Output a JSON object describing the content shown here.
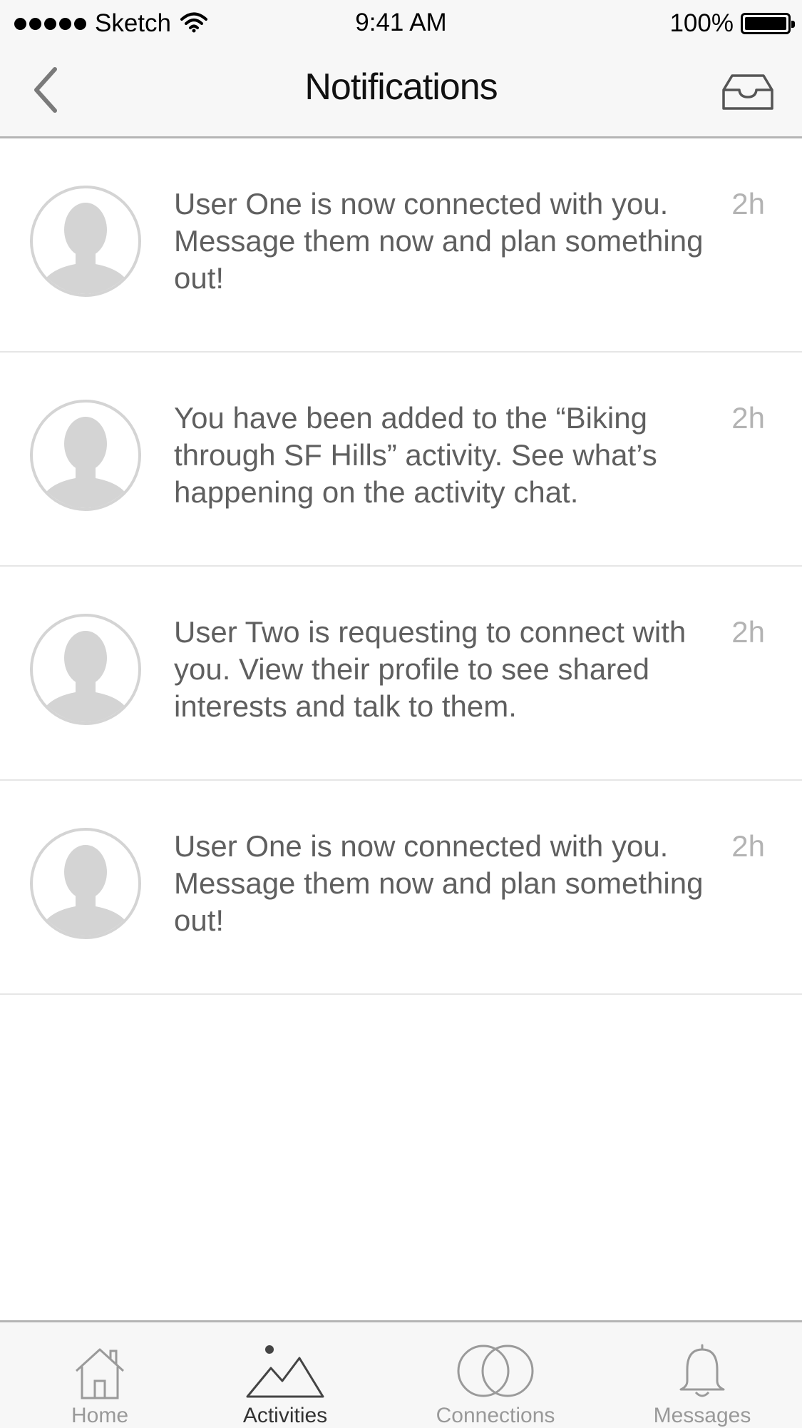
{
  "status_bar": {
    "carrier": "Sketch",
    "time": "9:41 AM",
    "battery": "100%",
    "signal_icon": "signal-dots-icon",
    "wifi_icon": "wifi-icon",
    "battery_icon": "battery-icon"
  },
  "nav": {
    "title": "Notifications",
    "back_icon": "chevron-left-icon",
    "inbox_icon": "inbox-tray-icon"
  },
  "notifications": [
    {
      "avatar_icon": "user-avatar-icon",
      "text": "User One is now connected with you. Message them now and plan something out!",
      "time": "2h"
    },
    {
      "avatar_icon": "user-avatar-icon",
      "text": "You have been added to the “Biking through SF Hills” activity. See what’s happening on the activity chat.",
      "time": "2h"
    },
    {
      "avatar_icon": "user-avatar-icon",
      "text": "User Two is requesting to connect with you. View their profile to see shared interests and talk to them.",
      "time": "2h"
    },
    {
      "avatar_icon": "user-avatar-icon",
      "text": "User One is now connected with you. Message them now and plan something out!",
      "time": "2h"
    }
  ],
  "tabs": [
    {
      "label": "Home",
      "icon": "home-icon",
      "active": false
    },
    {
      "label": "Activities",
      "icon": "mountain-icon",
      "active": true
    },
    {
      "label": "Connections",
      "icon": "connections-circles-icon",
      "active": false
    },
    {
      "label": "Messages",
      "icon": "bell-icon",
      "active": false
    }
  ],
  "colors": {
    "bar_background": "#f7f7f7",
    "text_primary": "#5f5f5f",
    "text_muted": "#b3b3b3",
    "divider": "#e6e6e6",
    "avatar_fill": "#d4d4d4"
  }
}
